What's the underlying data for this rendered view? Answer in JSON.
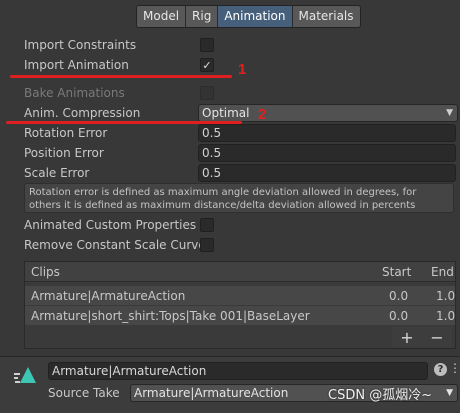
{
  "tabs": [
    "Model",
    "Rig",
    "Animation",
    "Materials"
  ],
  "settings": {
    "import_constraints": {
      "label": "Import Constraints",
      "checked": false
    },
    "import_animation": {
      "label": "Import Animation",
      "checked": true,
      "check_glyph": "✓"
    },
    "bake_animations": {
      "label": "Bake Animations",
      "checked": false
    },
    "anim_compression": {
      "label": "Anim. Compression",
      "value": "Optimal"
    },
    "rotation_error": {
      "label": "Rotation Error",
      "value": "0.5"
    },
    "position_error": {
      "label": "Position Error",
      "value": "0.5"
    },
    "scale_error": {
      "label": "Scale Error",
      "value": "0.5"
    },
    "help_text": "Rotation error is defined as maximum angle deviation allowed in degrees, for others it is defined as maximum distance/delta deviation allowed in percents",
    "animated_custom_properties": {
      "label": "Animated Custom Properties",
      "checked": false
    },
    "remove_constant_scale_curves": {
      "label": "Remove Constant Scale Curve",
      "checked": false
    }
  },
  "annotations": {
    "one": "1",
    "two": "2"
  },
  "clips": {
    "headers": {
      "clips": "Clips",
      "start": "Start",
      "end": "End"
    },
    "rows": [
      {
        "name": "Armature|ArmatureAction",
        "start": "0.0",
        "end": "1.0"
      },
      {
        "name": "Armature|short_shirt:Tops|Take 001|BaseLayer",
        "start": "0.0",
        "end": "1.0"
      }
    ],
    "add": "+",
    "remove": "−"
  },
  "clip_panel": {
    "name": "Armature|ArmatureAction",
    "help": "?",
    "menu": "⋮",
    "source_take_label": "Source Take",
    "source_take_value": "Armature|ArmatureAction"
  },
  "watermark": "CSDN @孤烟冷~",
  "colors": {
    "accent_tab": "#46607c",
    "annotation_red": "#e02020",
    "background": "#383838"
  }
}
